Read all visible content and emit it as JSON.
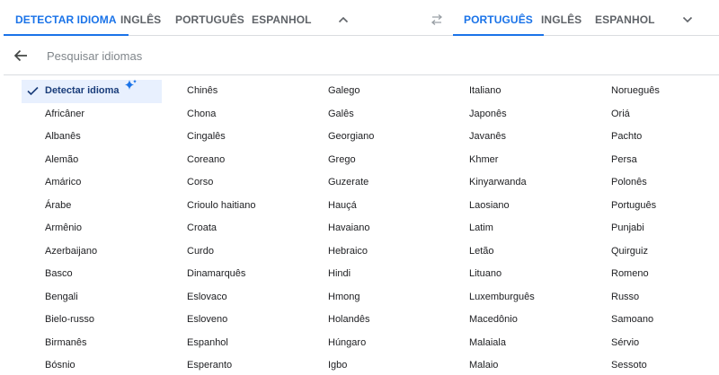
{
  "source_tabs": [
    "DETECTAR IDIOMA",
    "INGLÊS",
    "PORTUGUÊS",
    "ESPANHOL"
  ],
  "target_tabs": [
    "PORTUGUÊS",
    "INGLÊS",
    "ESPANHOL"
  ],
  "icons": {
    "source_toggle": "chevron-up-icon",
    "swap": "swap-languages-icon",
    "target_toggle": "chevron-down-icon",
    "back": "arrow-back-icon",
    "selected": "check-icon",
    "detect": "sparkle-icon"
  },
  "search": {
    "placeholder": "Pesquisar idiomas",
    "value": ""
  },
  "selected_language": "Detectar idioma",
  "colors": {
    "accent": "#1a73e8",
    "selected_bg": "#e8f0fe",
    "text": "#202124",
    "muted": "#5f6368",
    "divider": "#dadce0"
  },
  "languages": [
    [
      "Detectar idioma",
      "Africâner",
      "Albanês",
      "Alemão",
      "Amárico",
      "Árabe",
      "Armênio",
      "Azerbaijano",
      "Basco",
      "Bengali",
      "Bielo-russo",
      "Birmanês",
      "Bósnio"
    ],
    [
      "Chinês",
      "Chona",
      "Cingalês",
      "Coreano",
      "Corso",
      "Crioulo haitiano",
      "Croata",
      "Curdo",
      "Dinamarquês",
      "Eslovaco",
      "Esloveno",
      "Espanhol",
      "Esperanto"
    ],
    [
      "Galego",
      "Galês",
      "Georgiano",
      "Grego",
      "Guzerate",
      "Hauçá",
      "Havaiano",
      "Hebraico",
      "Hindi",
      "Hmong",
      "Holandês",
      "Húngaro",
      "Igbo"
    ],
    [
      "Italiano",
      "Japonês",
      "Javanês",
      "Khmer",
      "Kinyarwanda",
      "Laosiano",
      "Latim",
      "Letão",
      "Lituano",
      "Luxemburguês",
      "Macedônio",
      "Malaiala",
      "Malaio"
    ],
    [
      "Norueguês",
      "Oriá",
      "Pachto",
      "Persa",
      "Polonês",
      "Português",
      "Punjabi",
      "Quirguiz",
      "Romeno",
      "Russo",
      "Samoano",
      "Sérvio",
      "Sessoto"
    ]
  ]
}
